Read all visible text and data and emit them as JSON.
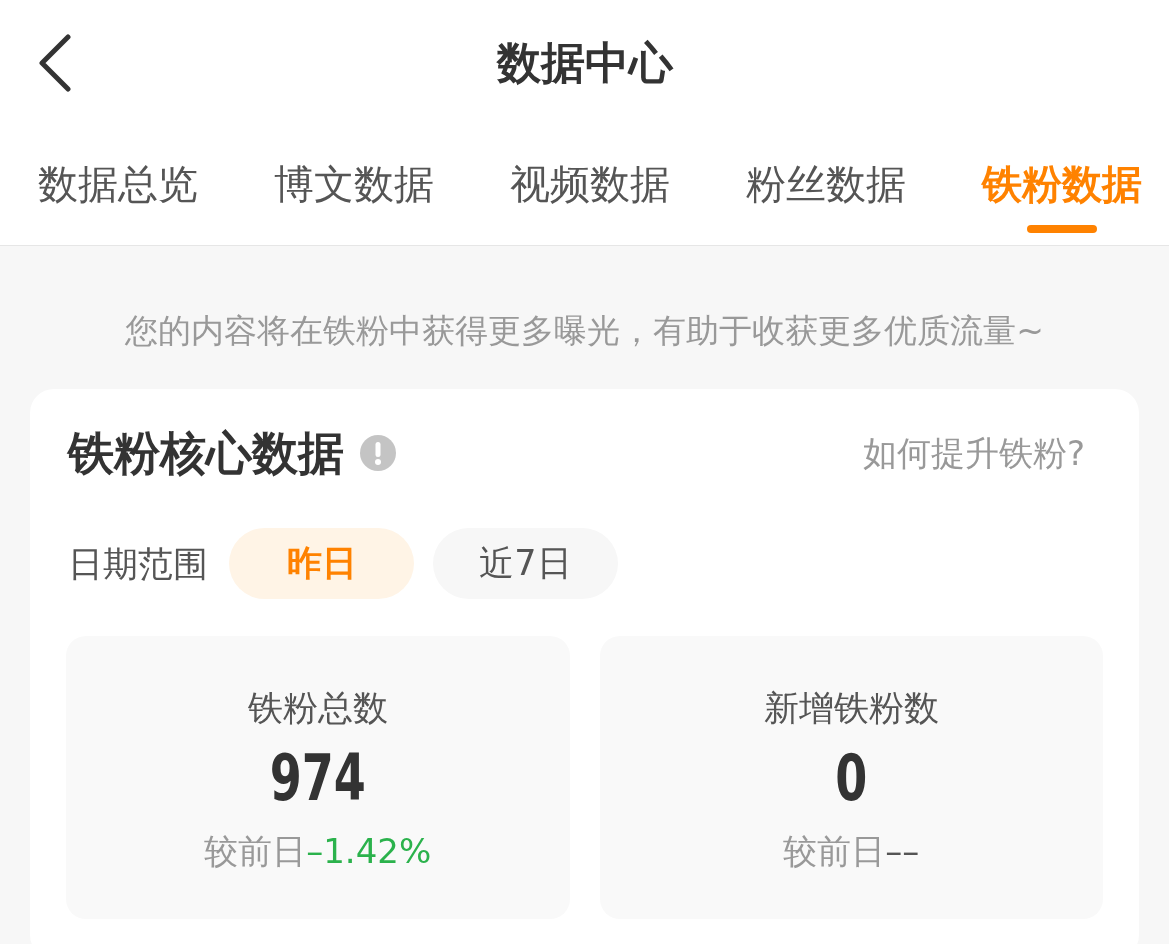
{
  "header": {
    "title": "数据中心"
  },
  "tabs": [
    {
      "label": "数据总览",
      "selected": false
    },
    {
      "label": "博文数据",
      "selected": false
    },
    {
      "label": "视频数据",
      "selected": false
    },
    {
      "label": "粉丝数据",
      "selected": false
    },
    {
      "label": "铁粉数据",
      "selected": true
    }
  ],
  "notice": "您的内容将在铁粉中获得更多曝光，有助于收获更多优质流量~",
  "core_card": {
    "title": "铁粉核心数据",
    "help_link": "如何提升铁粉?",
    "date_range": {
      "label": "日期范围",
      "options": [
        {
          "label": "昨日",
          "selected": true
        },
        {
          "label": "近7日",
          "selected": false
        }
      ]
    },
    "stats": [
      {
        "label": "铁粉总数",
        "value": "974",
        "comparison_label": "较前日",
        "change": "–1.42%",
        "color": "#2bb24c"
      },
      {
        "label": "新增铁粉数",
        "value": "0",
        "comparison_label": "较前日",
        "change": "––",
        "color": "#555555"
      }
    ]
  }
}
